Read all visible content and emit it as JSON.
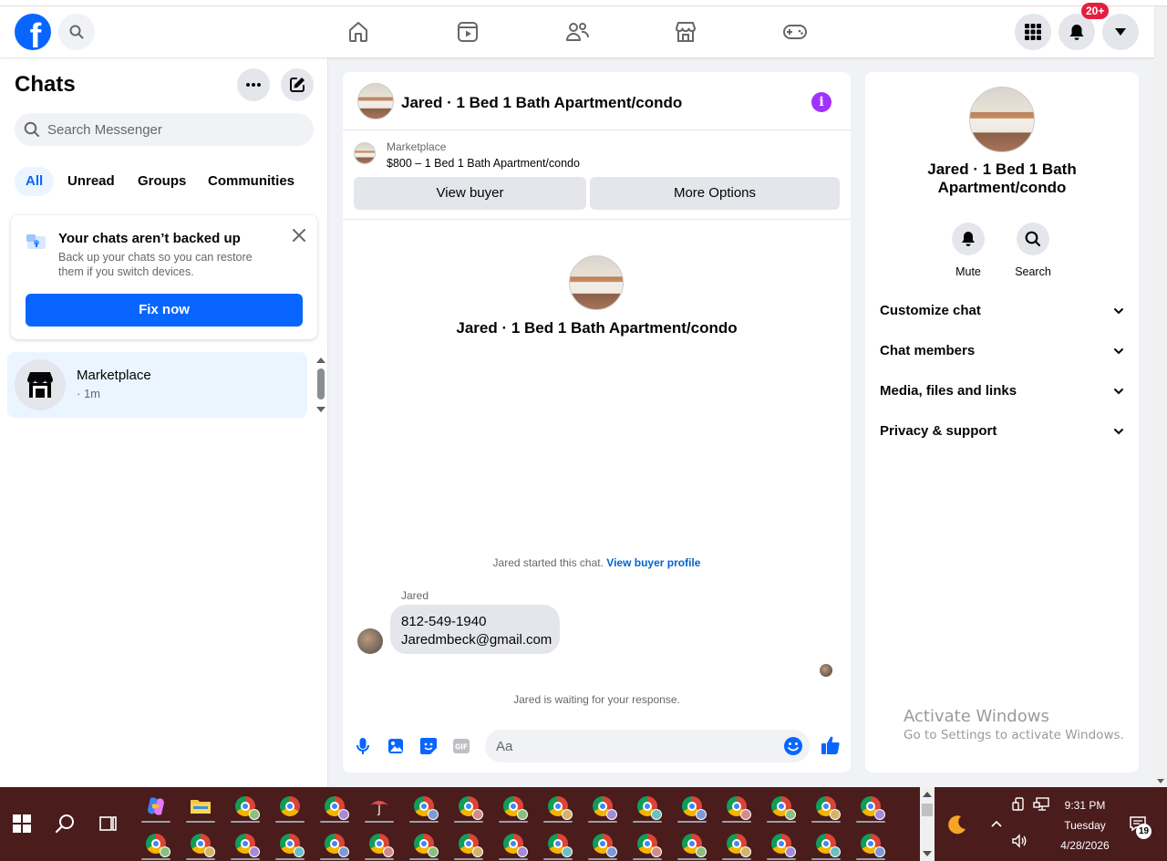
{
  "header": {
    "notif_badge": "20+"
  },
  "left": {
    "title": "Chats",
    "search_placeholder": "Search Messenger",
    "filters": [
      "All",
      "Unread",
      "Groups",
      "Communities"
    ],
    "backup": {
      "title": "Your chats aren’t backed up",
      "desc": "Back up your chats so you can restore them if you switch devices.",
      "button": "Fix now"
    },
    "chat_item": {
      "name": "Marketplace",
      "time": "· 1m"
    }
  },
  "center": {
    "title": "Jared · 1 Bed 1 Bath Apartment/condo",
    "marketplace_label": "Marketplace",
    "listing": "$800 – 1 Bed 1 Bath Apartment/condo",
    "view_buyer": "View buyer",
    "more_options": "More Options",
    "intro_name": "Jared · 1 Bed 1 Bath Apartment/condo",
    "started_text": "Jared started this chat.",
    "started_link": "View buyer profile",
    "sender": "Jared",
    "message_line1": "812-549-1940",
    "message_line2": "Jaredmbeck@gmail.com",
    "waiting": "Jared is waiting for your response.",
    "composer_placeholder": "Aa"
  },
  "right": {
    "name": "Jared · 1 Bed 1 Bath Apartment/condo",
    "mute": "Mute",
    "search": "Search",
    "sections": [
      "Customize chat",
      "Chat members",
      "Media, files and links",
      "Privacy & support"
    ]
  },
  "watermark": {
    "line1": "Activate Windows",
    "line2": "Go to Settings to activate Windows."
  },
  "taskbar": {
    "time": "9:31 PM",
    "day": "Tuesday",
    "date": "4/28/2026",
    "notification_count": "19"
  },
  "colors": {
    "brand": "#0866ff",
    "info": "#a033ff",
    "taskbar": "#4a1c1c"
  }
}
